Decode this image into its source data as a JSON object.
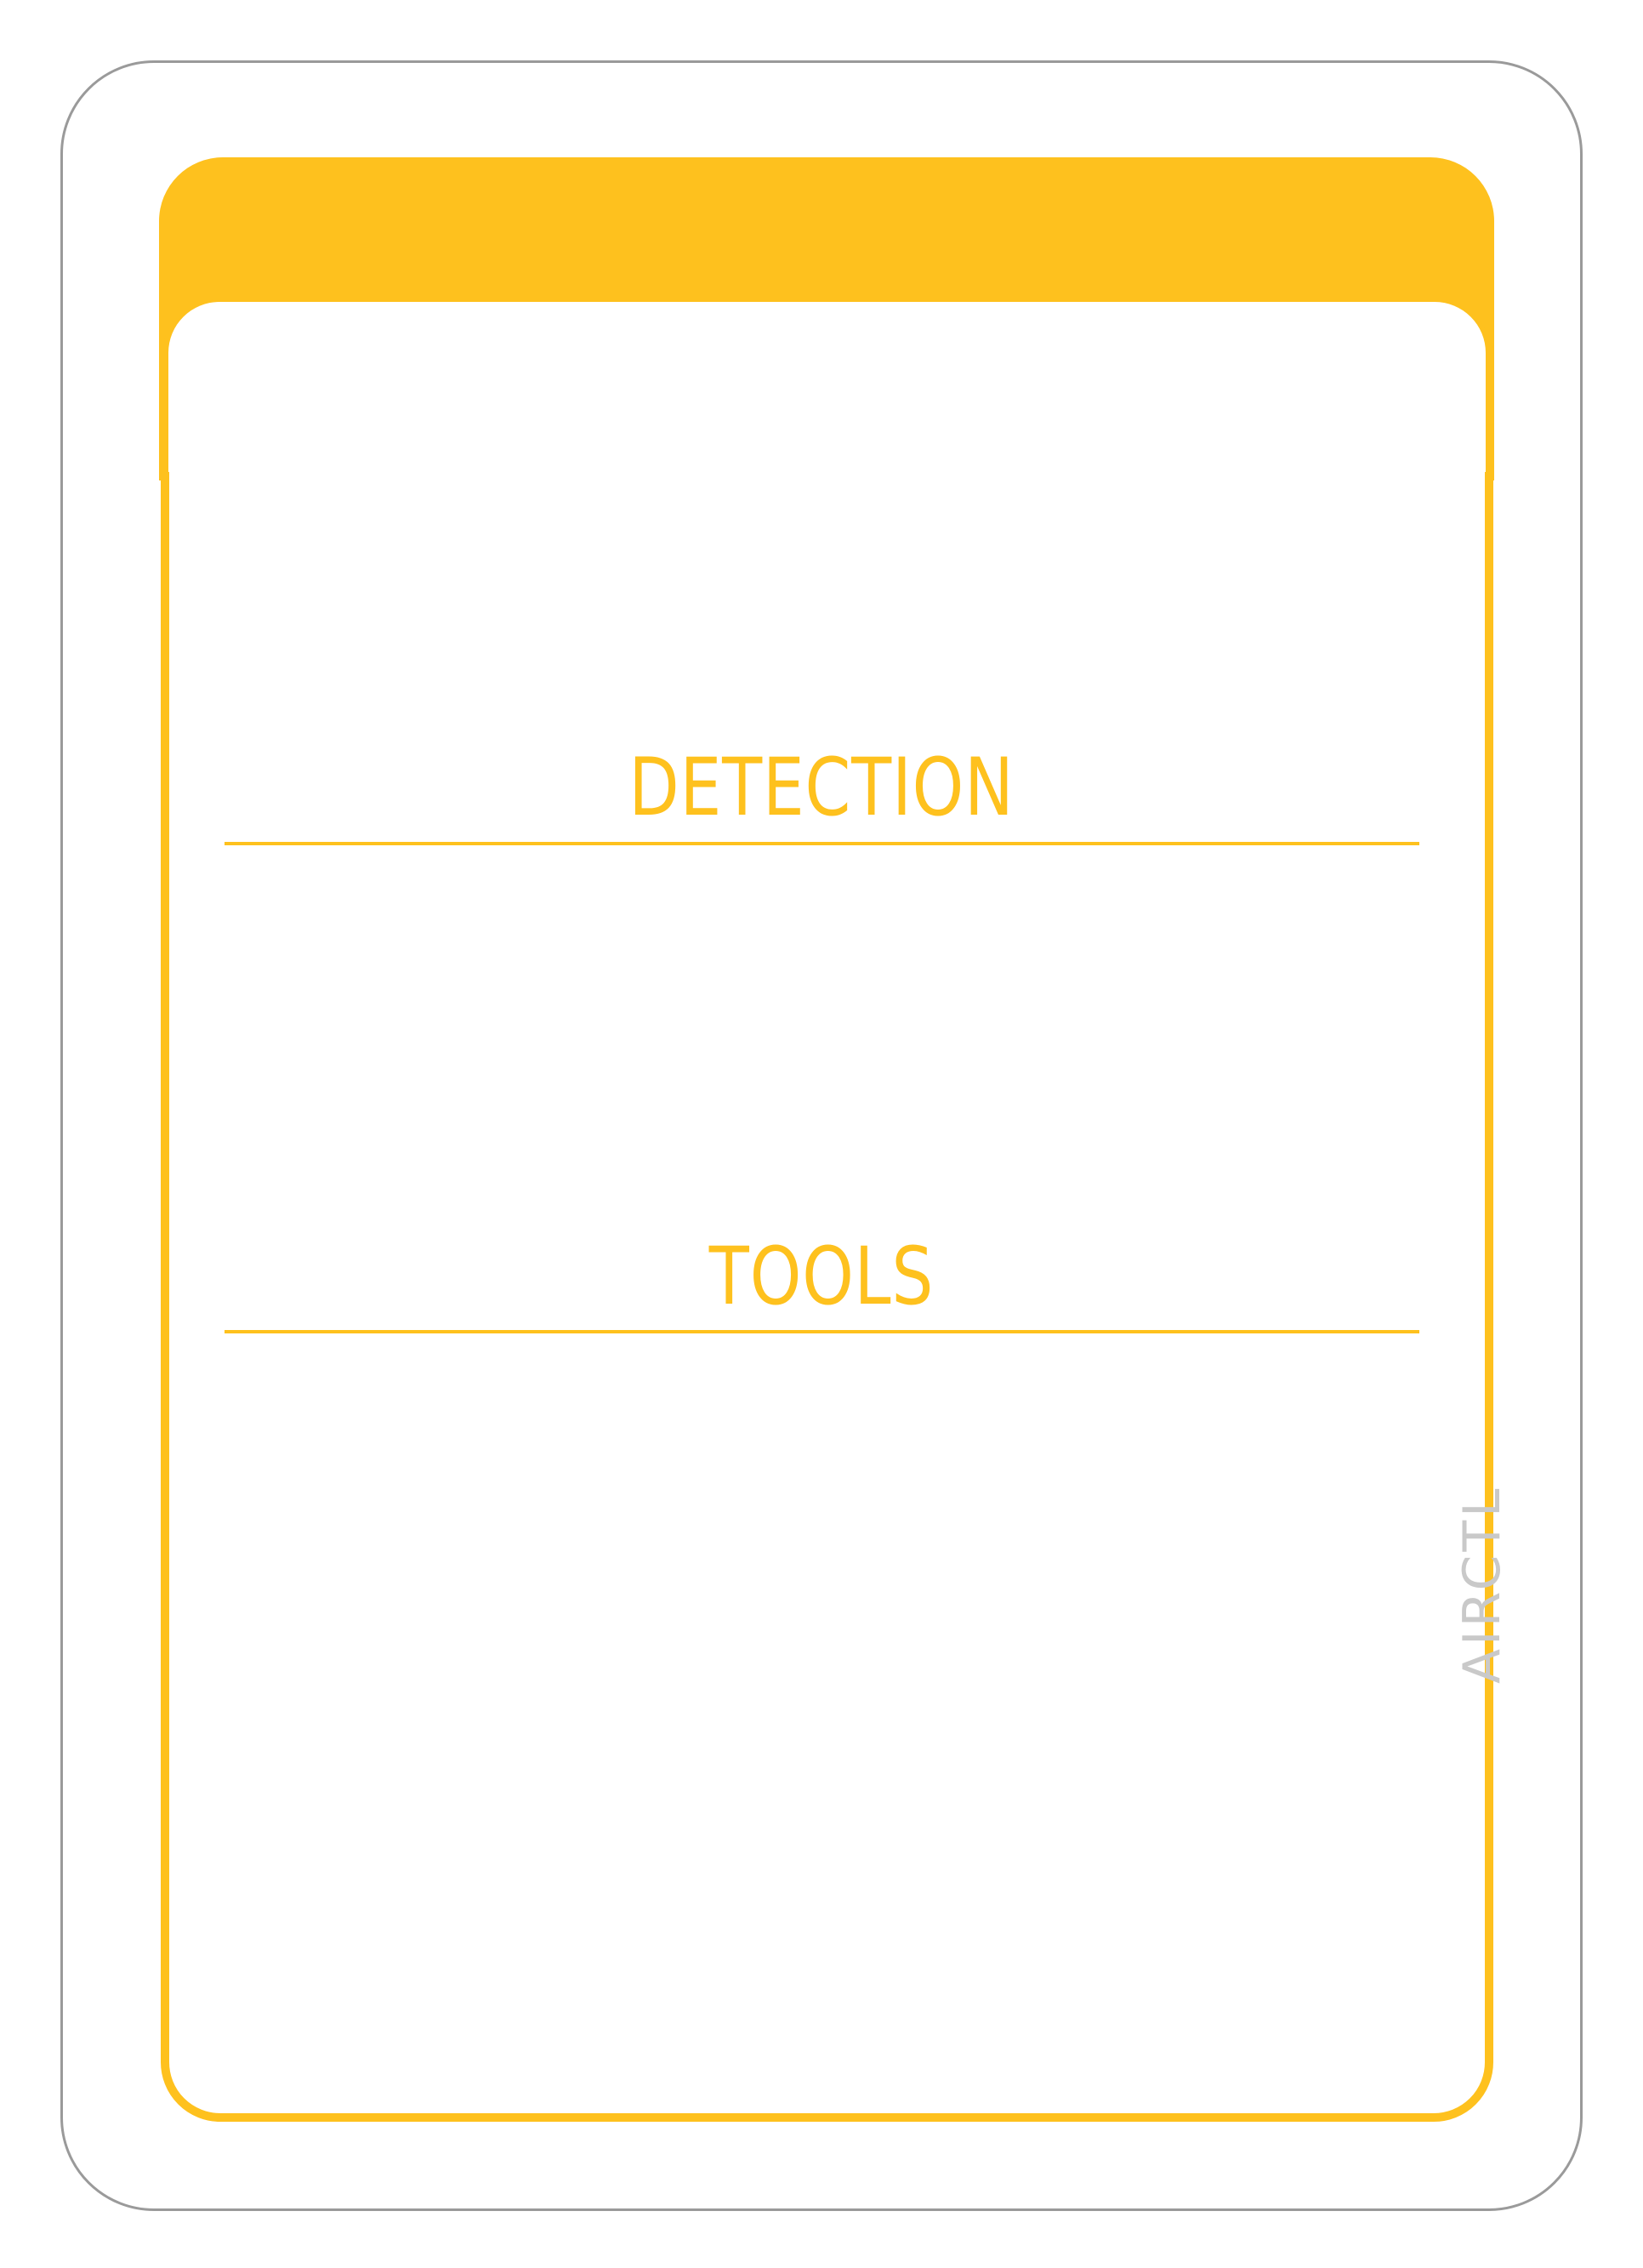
{
  "card": {
    "sections": [
      {
        "heading": "DETECTION"
      },
      {
        "heading": "TOOLS"
      }
    ],
    "side_label": "AIRCTL"
  },
  "colors": {
    "accent": "#FEC11E",
    "outline": "#9A9A9A",
    "side_label": "#C9C9C9"
  }
}
